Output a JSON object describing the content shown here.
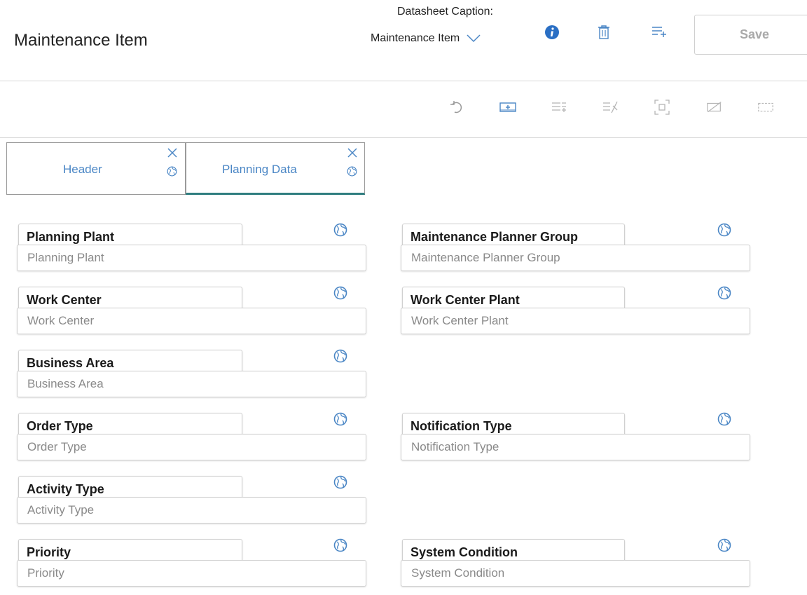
{
  "header": {
    "title": "Maintenance Item",
    "caption_label": "Datasheet Caption:",
    "caption_value": "Maintenance Item",
    "save_label": "Save",
    "icons": [
      "info-icon",
      "delete-icon",
      "add-list-icon"
    ]
  },
  "toolbar": {
    "icons": [
      "undo-icon",
      "add-field-icon",
      "list-add-icon",
      "list-remove-icon",
      "frame-icon",
      "hide-icon",
      "border-icon"
    ]
  },
  "tabs": [
    {
      "label": "Header",
      "active": false
    },
    {
      "label": "Planning Data",
      "active": true
    }
  ],
  "fields": {
    "planning_plant": {
      "label": "Planning Plant",
      "placeholder": "Planning Plant"
    },
    "maintenance_planner_group": {
      "label": "Maintenance Planner Group",
      "placeholder": "Maintenance Planner Group"
    },
    "work_center": {
      "label": "Work Center",
      "placeholder": "Work Center"
    },
    "work_center_plant": {
      "label": "Work Center Plant",
      "placeholder": "Work Center Plant"
    },
    "business_area": {
      "label": "Business Area",
      "placeholder": "Business Area"
    },
    "order_type": {
      "label": "Order Type",
      "placeholder": "Order Type"
    },
    "notification_type": {
      "label": "Notification Type",
      "placeholder": "Notification Type"
    },
    "activity_type": {
      "label": "Activity Type",
      "placeholder": "Activity Type"
    },
    "priority": {
      "label": "Priority",
      "placeholder": "Priority"
    },
    "system_condition": {
      "label": "System Condition",
      "placeholder": "System Condition"
    }
  },
  "colors": {
    "accent_blue": "#4a86c5",
    "active_tab_underline": "#2f7d7f",
    "save_text": "#a9a9a9"
  }
}
